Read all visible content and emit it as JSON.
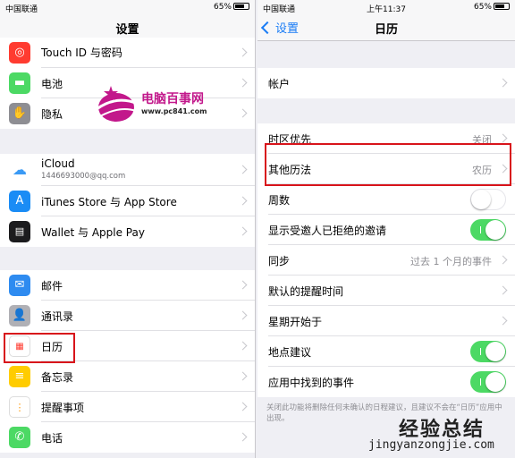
{
  "left": {
    "status": {
      "carrier": "中国联通",
      "battery": "65%"
    },
    "title": "设置",
    "rows": [
      {
        "label": "Touch ID 与密码",
        "icon": "fingerprint-icon",
        "color": "#ff3b30"
      },
      {
        "label": "电池",
        "icon": "battery-icon",
        "color": "#4cd964"
      },
      {
        "label": "隐私",
        "icon": "hand-icon",
        "color": "#8e8e93"
      },
      {
        "label": "iCloud",
        "sub": "1446693000@qq.com",
        "icon": "cloud-icon",
        "color": "#ffffff"
      },
      {
        "label": "iTunes Store 与 App Store",
        "icon": "app-store-icon",
        "color": "#1a8cf5"
      },
      {
        "label": "Wallet 与 Apple Pay",
        "icon": "wallet-icon",
        "color": "#1c1c1e"
      },
      {
        "label": "邮件",
        "icon": "mail-icon",
        "color": "#2e8bf0"
      },
      {
        "label": "通讯录",
        "icon": "contacts-icon",
        "color": "#b0b0b5"
      },
      {
        "label": "日历",
        "icon": "calendar-icon",
        "color": "#ffffff"
      },
      {
        "label": "备忘录",
        "icon": "notes-icon",
        "color": "#ffcc00"
      },
      {
        "label": "提醒事项",
        "icon": "reminders-icon",
        "color": "#ffffff"
      },
      {
        "label": "电话",
        "icon": "phone-icon",
        "color": "#4cd964"
      }
    ]
  },
  "right": {
    "status": {
      "carrier": "中国联通",
      "time": "上午11:37",
      "battery": "65%"
    },
    "back_label": "设置",
    "title": "日历",
    "rows": [
      {
        "label": "帐户",
        "value": "",
        "type": "chevron"
      },
      {
        "label": "时区优先",
        "value": "关闭",
        "type": "chevron"
      },
      {
        "label": "其他历法",
        "value": "农历",
        "type": "chevron"
      },
      {
        "label": "周数",
        "type": "toggle",
        "on": false
      },
      {
        "label": "显示受邀人已拒绝的邀请",
        "type": "toggle",
        "on": true
      },
      {
        "label": "同步",
        "value": "过去 1 个月的事件",
        "type": "chevron"
      },
      {
        "label": "默认的提醒时间",
        "value": "",
        "type": "chevron"
      },
      {
        "label": "星期开始于",
        "value": "",
        "type": "chevron"
      },
      {
        "label": "地点建议",
        "type": "toggle",
        "on": true
      },
      {
        "label": "应用中找到的事件",
        "type": "toggle",
        "on": true
      }
    ],
    "footer": "关闭此功能将删除任何未确认的日程建议，且建议不会在“日历”应用中出现。"
  },
  "watermark": {
    "name": "电脑百事网",
    "url": "www.pc841.com",
    "name2": "经验总结",
    "url2": "jingyanzongjie.com"
  }
}
